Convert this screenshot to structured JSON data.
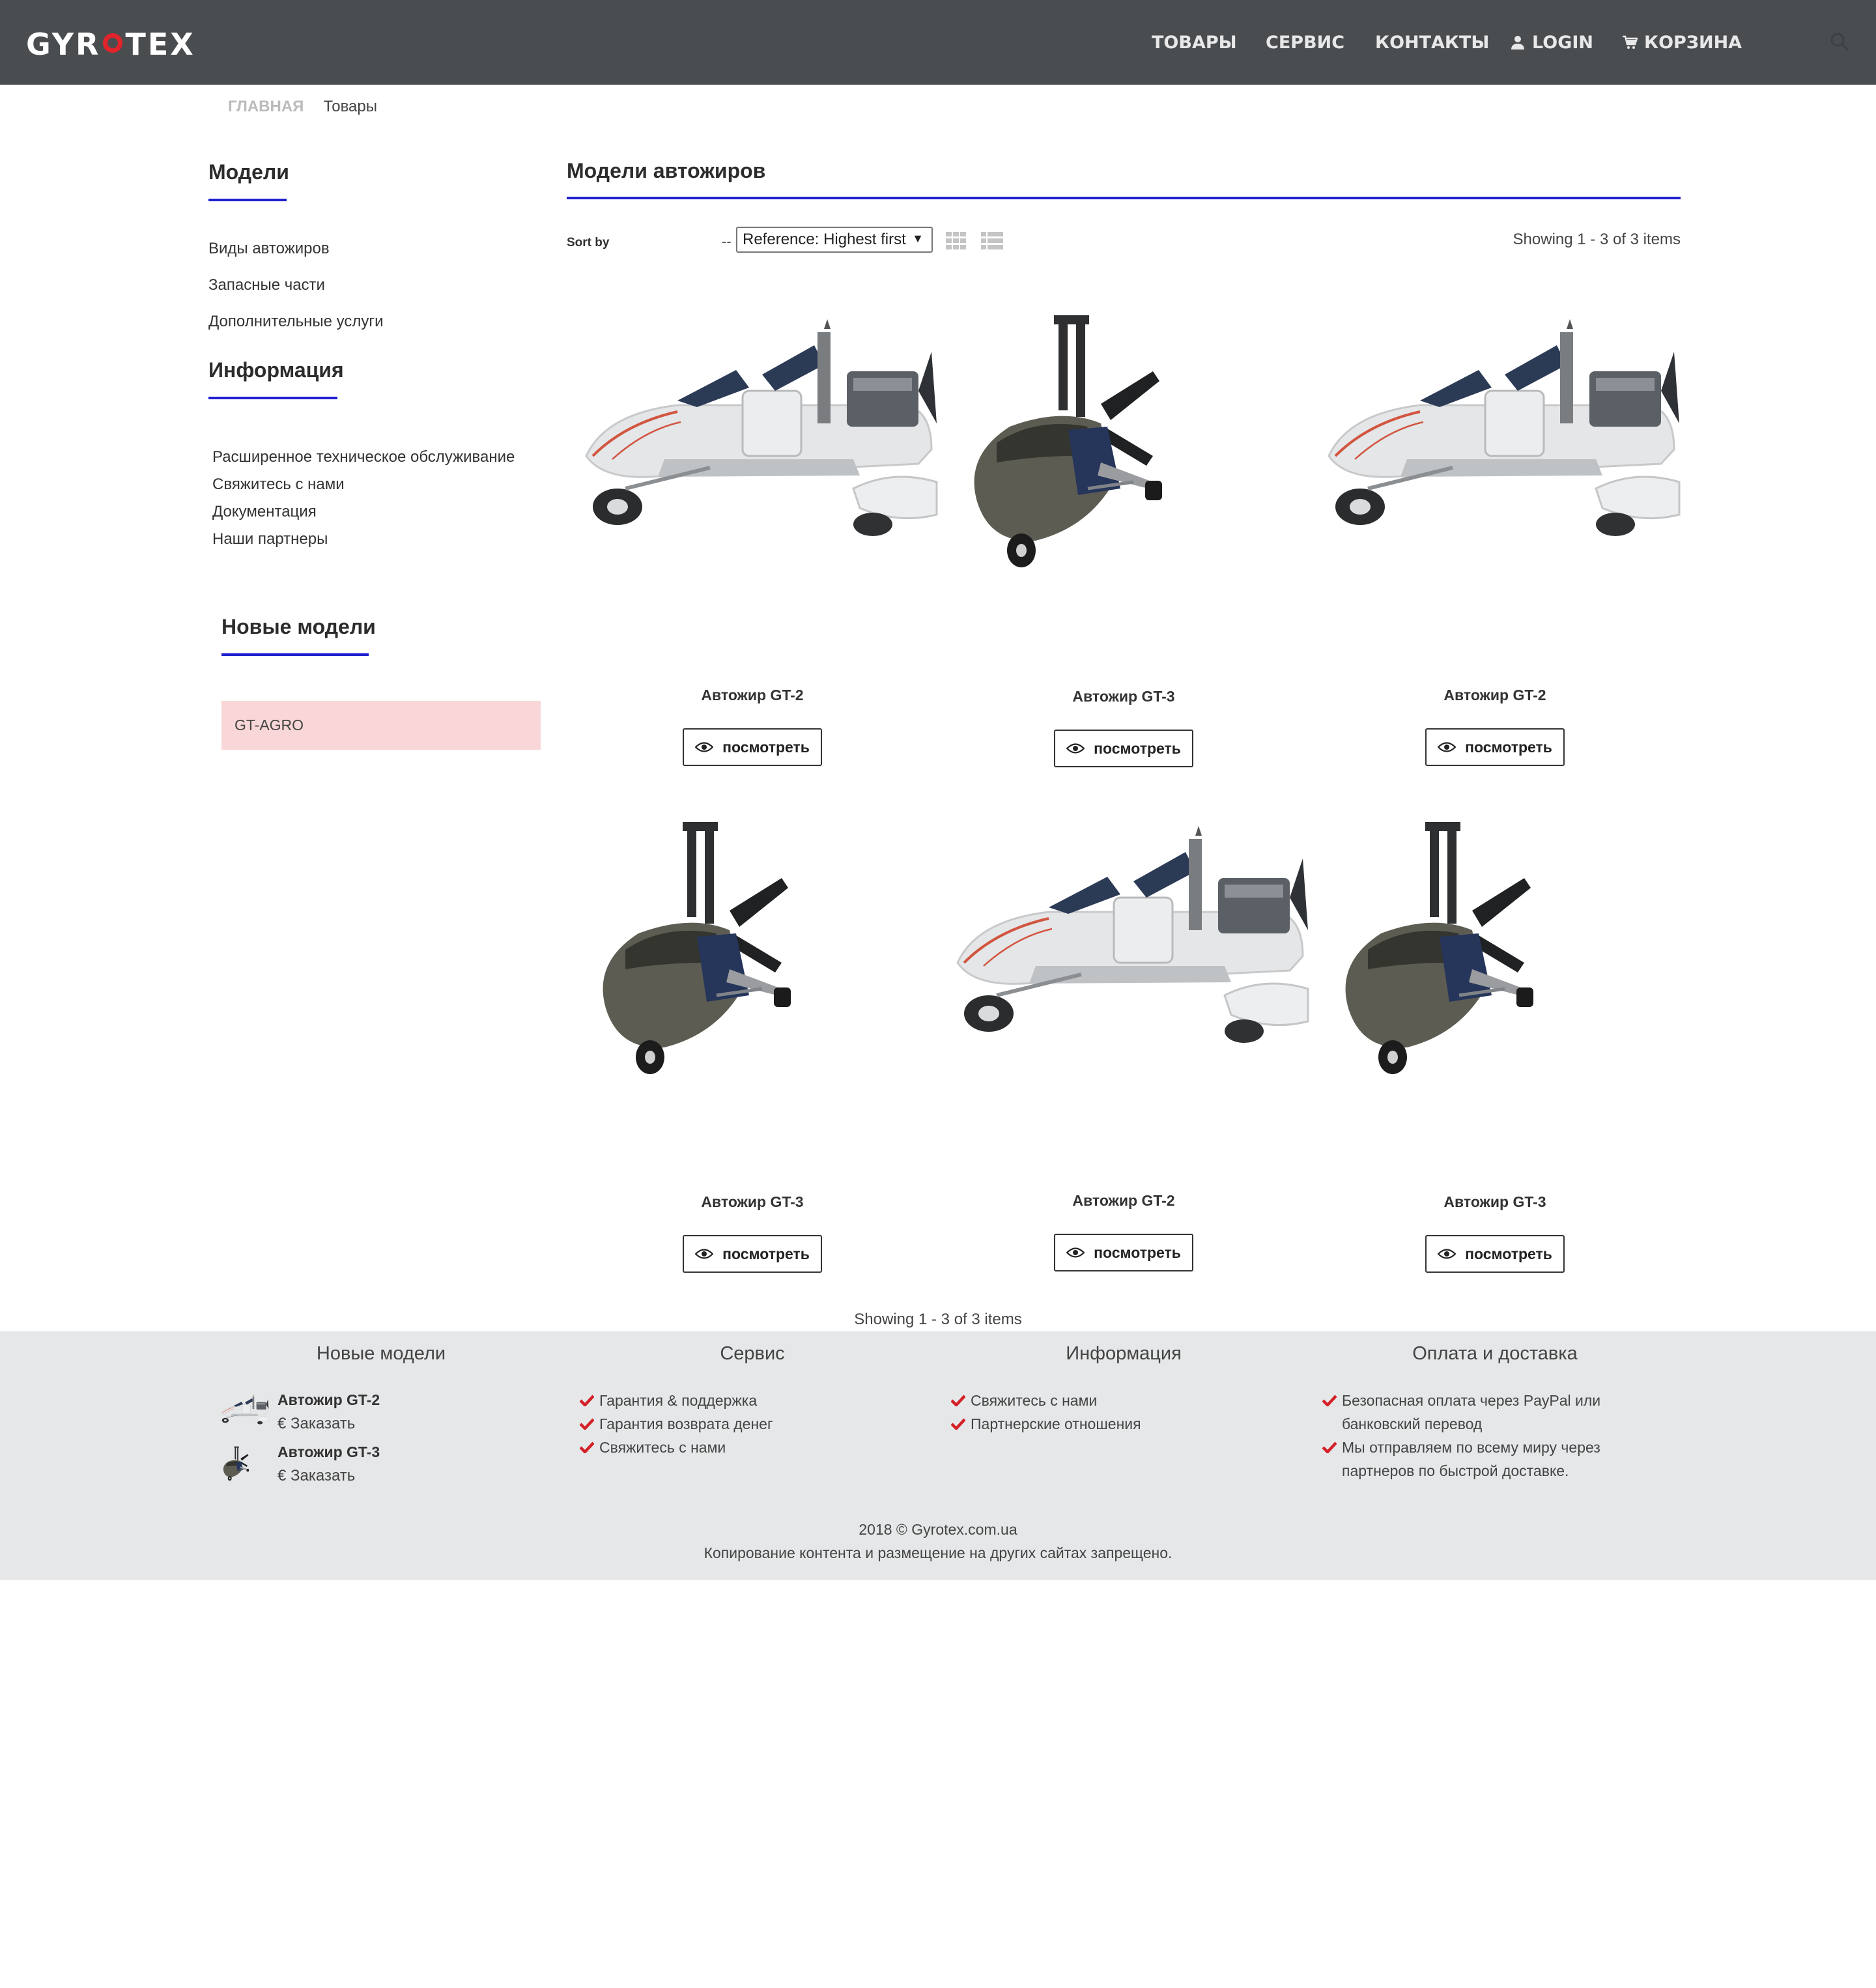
{
  "header": {
    "logo": "GYROTEX",
    "nav": [
      {
        "label": "ТОВАРЫ",
        "icon": null
      },
      {
        "label": "СЕРВИС",
        "icon": null
      },
      {
        "label": "КОНТАКТЫ",
        "icon": null
      },
      {
        "label": "LOGIN",
        "icon": "user-icon"
      },
      {
        "label": "КОРЗИНА",
        "icon": "cart-icon"
      }
    ],
    "search_icon": "search-icon"
  },
  "breadcrumb": {
    "home": "ГЛАВНАЯ",
    "current": "Товары"
  },
  "sidebar": {
    "models_title": "Модели",
    "models_links": [
      "Виды автожиров",
      "Запасные части",
      "Дополнительные услуги"
    ],
    "info_title": "Информация",
    "info_links": [
      "Расширенное техническое обслуживание",
      "Свяжитесь с нами",
      "Документация",
      "Наши партнеры"
    ],
    "new_title": "Новые модели",
    "new_item": "GT-AGRO"
  },
  "main": {
    "title": "Модели автожиров",
    "sort_label": "Sort by",
    "sort_dash": "--",
    "sort_value": "Reference: Highest first",
    "showing": "Showing 1 - 3 of 3 items",
    "view_label": "посмотреть",
    "products": [
      {
        "name": "Автожир GT-2",
        "kind": "gt2"
      },
      {
        "name": "Автожир GT-3",
        "kind": "gt3"
      },
      {
        "name": "Автожир GT-2",
        "kind": "gt2"
      },
      {
        "name": "Автожир GT-3",
        "kind": "gt3"
      },
      {
        "name": "Автожир GT-2",
        "kind": "gt2"
      },
      {
        "name": "Автожир GT-3",
        "kind": "gt3"
      }
    ]
  },
  "footer": {
    "col_new_title": "Новые модели",
    "col_service_title": "Сервис",
    "col_info_title": "Информация",
    "col_pay_title": "Оплата и доставка",
    "new_products": [
      {
        "name": "Автожир GT-2",
        "order": "€ Заказать"
      },
      {
        "name": "Автожир GT-3",
        "order": "€ Заказать"
      }
    ],
    "service_items": [
      "Гарантия & поддержка",
      "Гарантия возврата денег",
      "Свяжитесь с нами"
    ],
    "info_items": [
      "Свяжитесь с нами",
      "Партнерские отношения"
    ],
    "pay_items": [
      "Безопасная оплата через PayPal или банковский перевод",
      "Мы отправляем по всему миру через партнеров по быстрой доставке."
    ],
    "copyright_line1": "2018 © Gyrotex.com.ua",
    "copyright_line2": "Копирование контента и размещение на других сайтах запрещено."
  },
  "colors": {
    "header_bg": "#4a4d50",
    "accent_blue": "#2020d0",
    "logo_red": "#e0242a",
    "check_red": "#d42027",
    "highlight_pink": "#f9d6d7",
    "footer_bg": "#e6e7e8"
  }
}
